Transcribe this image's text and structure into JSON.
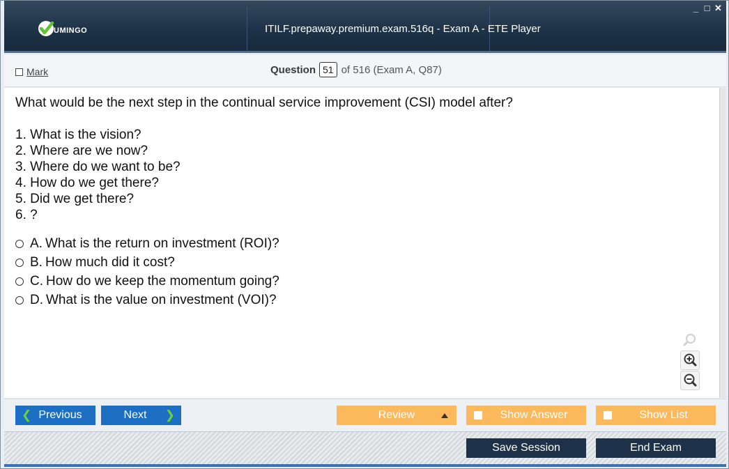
{
  "window": {
    "title": "ITILF.prepaway.premium.exam.516q - Exam A - ETE Player",
    "logo_text": "UMINGO",
    "controls": {
      "minimize": "_",
      "maximize": "□",
      "close": "✕"
    }
  },
  "header": {
    "mark_label": "Mark",
    "question_label": "Question",
    "question_number": "51",
    "question_of": "of 516 (Exam A, Q87)"
  },
  "question": {
    "text": "What would be the next step in the continual service improvement (CSI) model after?",
    "steps": [
      "1. What is the vision?",
      "2. Where are we now?",
      "3. Where do we want to be?",
      "4. How do we get there?",
      "5. Did we get there?",
      "6. ?"
    ],
    "answers": [
      {
        "letter": "A.",
        "text": "What is the return on investment (ROI)?"
      },
      {
        "letter": "B.",
        "text": "How much did it cost?"
      },
      {
        "letter": "C.",
        "text": "How do we keep the momentum going?"
      },
      {
        "letter": "D.",
        "text": "What is the value on investment (VOI)?"
      }
    ]
  },
  "nav": {
    "previous": "Previous",
    "next": "Next",
    "review": "Review",
    "show_answer": "Show Answer",
    "show_list": "Show List",
    "save_session": "Save Session",
    "end_exam": "End Exam"
  },
  "colors": {
    "title_bg": "#1d3247",
    "nav_blue": "#1d6fc3",
    "nav_orange": "#fbb85d",
    "dark_button": "#1d3248",
    "arrow_green": "#6fcf3f",
    "logo_green": "#5cc531"
  },
  "icons": {
    "logo": "check-icon",
    "zoom": [
      "zoom-reset-icon",
      "zoom-in-icon",
      "zoom-out-icon"
    ]
  }
}
